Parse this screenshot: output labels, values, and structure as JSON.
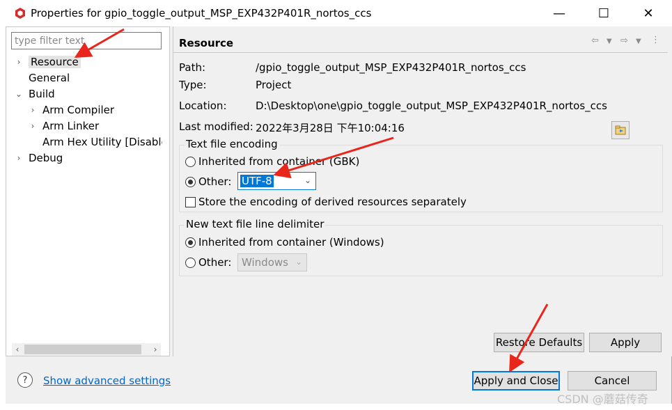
{
  "window": {
    "title": "Properties for gpio_toggle_output_MSP_EXP432P401R_nortos_ccs",
    "minimize_glyph": "—",
    "maximize_glyph": "☐",
    "close_glyph": "✕"
  },
  "filter": {
    "placeholder": "type filter text"
  },
  "tree": [
    {
      "label": "Resource",
      "twisty": "›",
      "selected": true
    },
    {
      "label": "General",
      "twisty": ""
    },
    {
      "label": "Build",
      "twisty": "⌄"
    },
    {
      "label": "Arm Compiler",
      "twisty": "›"
    },
    {
      "label": "Arm Linker",
      "twisty": "›"
    },
    {
      "label": "Arm Hex Utility  [Disable",
      "twisty": ""
    },
    {
      "label": "Debug",
      "twisty": "›"
    }
  ],
  "resource": {
    "title": "Resource",
    "path_label": "Path:",
    "path_value": "/gpio_toggle_output_MSP_EXP432P401R_nortos_ccs",
    "type_label": "Type:",
    "type_value": "Project",
    "location_label": "Location:",
    "location_value": "D:\\Desktop\\one\\gpio_toggle_output_MSP_EXP432P401R_nortos_ccs",
    "modified_label": "Last modified:",
    "modified_value": "2022年3月28日 下午10:04:16"
  },
  "encoding": {
    "group_title": "Text file encoding",
    "inherited_label": "Inherited from container (GBK)",
    "other_label": "Other:",
    "other_value": "UTF-8",
    "store_label": "Store the encoding of derived resources separately"
  },
  "delimiter": {
    "group_title": "New text file line delimiter",
    "inherited_label": "Inherited from container (Windows)",
    "other_label": "Other:",
    "other_value": "Windows"
  },
  "buttons": {
    "restore": "Restore Defaults",
    "apply": "Apply",
    "apply_close": "Apply and Close",
    "cancel": "Cancel"
  },
  "footer": {
    "help_glyph": "?",
    "advanced_link": "Show advanced settings"
  },
  "watermark": "CSDN @蘑菇传奇",
  "colors": {
    "accent": "#0078d7",
    "link": "#0066cc",
    "annotation_arrow": "#e8261c"
  }
}
